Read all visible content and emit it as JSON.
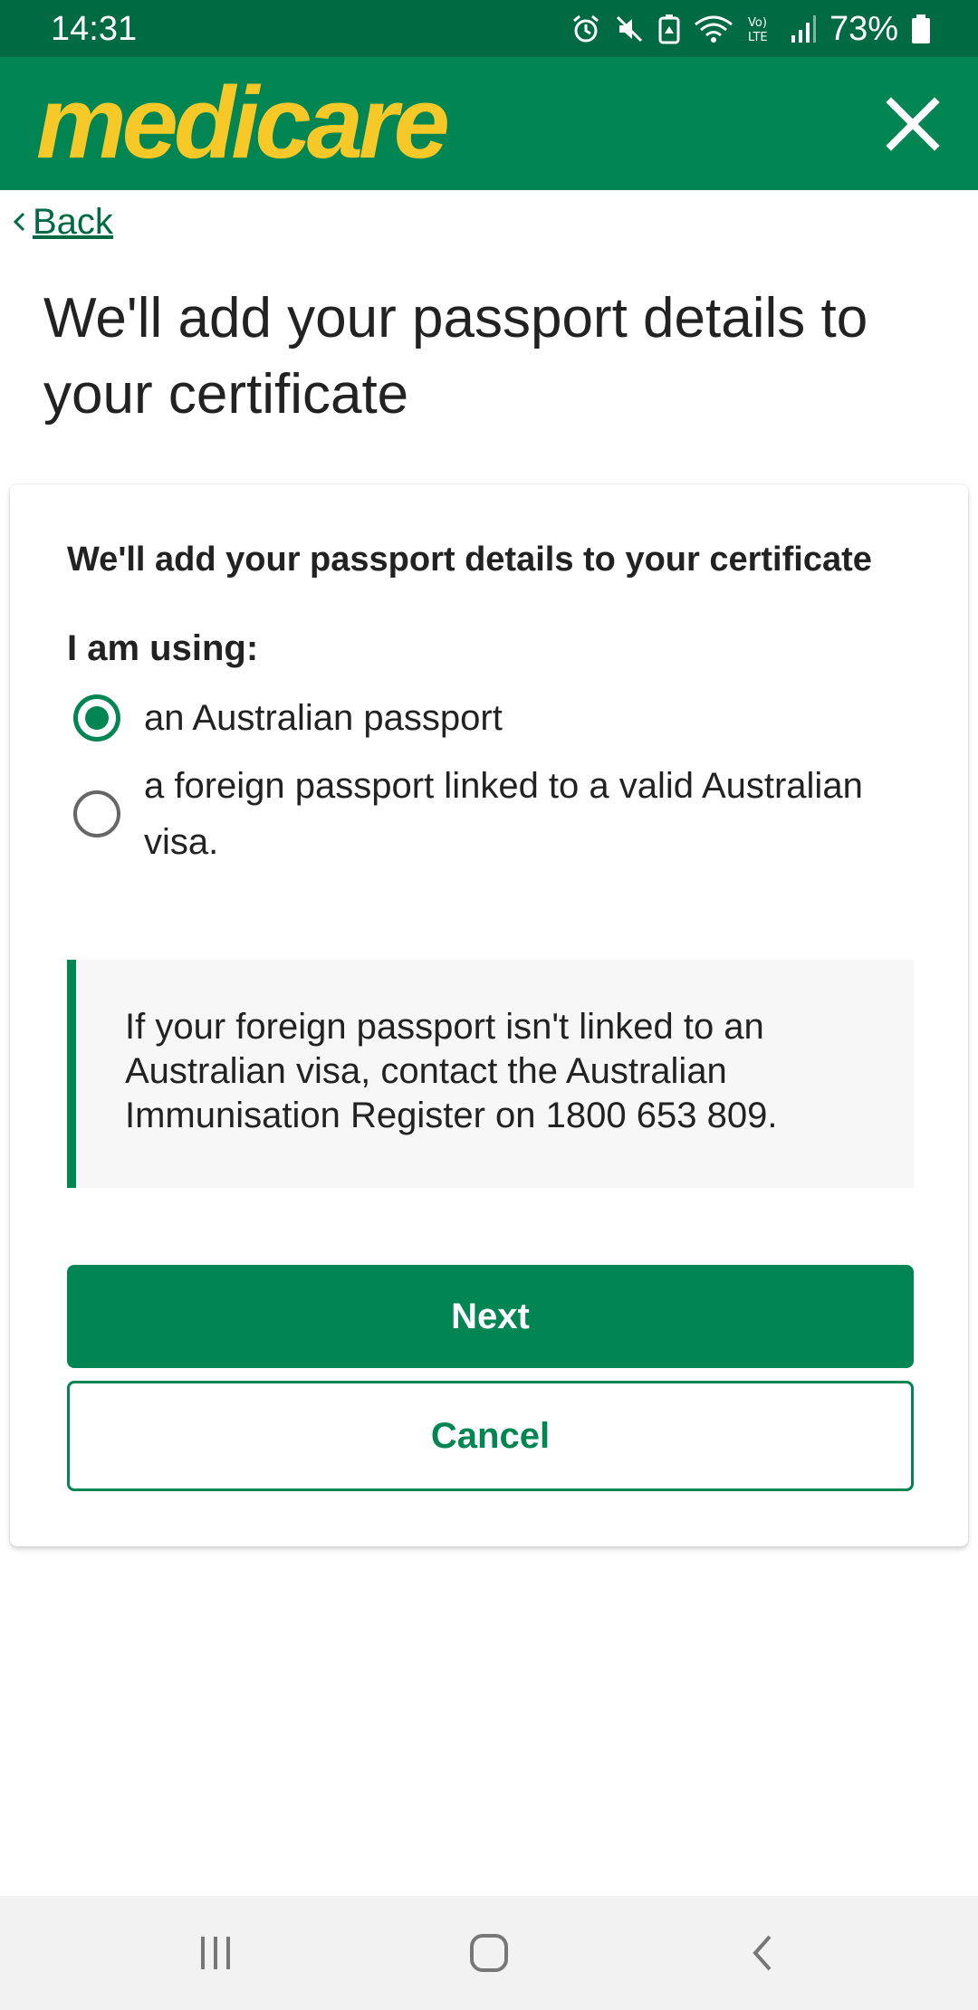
{
  "status_bar": {
    "time": "14:31",
    "battery": "73%",
    "icons": [
      "alarm-icon",
      "mute-icon",
      "battery-saver-icon",
      "wifi-icon",
      "volte-lte-icon",
      "signal-icon",
      "battery-icon"
    ]
  },
  "app_bar": {
    "logo": "medicare",
    "close_icon": "close-icon",
    "brand_color": "#008553",
    "logo_color": "#f6c928"
  },
  "back": {
    "label": "Back"
  },
  "page": {
    "title": "We'll add your passport details to your certificate"
  },
  "card": {
    "heading": "We'll add your passport details to your certificate",
    "question": "I am using:",
    "options": [
      {
        "label": "an Australian passport",
        "selected": true
      },
      {
        "label": "a foreign passport linked to a valid Australian visa.",
        "selected": false
      }
    ],
    "info": "If your foreign passport isn't linked to an Australian visa, contact the Australian Immunisation Register on 1800 653 809.",
    "next_label": "Next",
    "cancel_label": "Cancel"
  },
  "nav_bar": {
    "icons": [
      "recent-apps-icon",
      "home-icon",
      "back-nav-icon"
    ]
  }
}
